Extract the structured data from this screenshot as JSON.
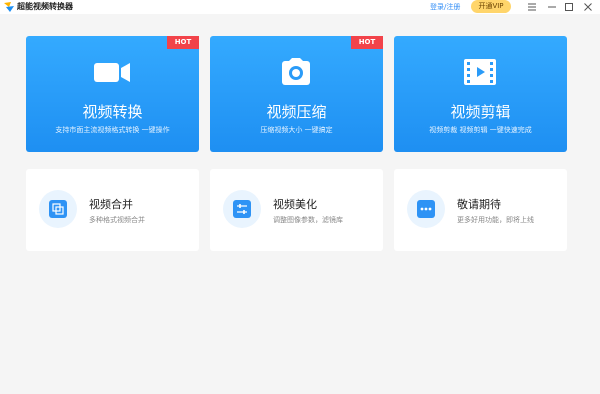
{
  "app": {
    "title": "超能视频转换器"
  },
  "header": {
    "login_label": "登录/注册",
    "vip_label": "开通VIP"
  },
  "window_controls": [
    "menu-icon",
    "minimize-icon",
    "maximize-icon",
    "close-icon"
  ],
  "colors": {
    "accent": "#2e93f5",
    "card_blue": "#1e8ff2",
    "hot_badge": "#f2434a",
    "vip": "#ffd56b"
  },
  "features": [
    {
      "title": "视频转换",
      "subtitle": "支持市面主流视频格式转换 一键操作",
      "badge": "HOT",
      "icon": "video-camera-icon"
    },
    {
      "title": "视频压缩",
      "subtitle": "压缩视频大小 一键搞定",
      "badge": "HOT",
      "icon": "camera-icon"
    },
    {
      "title": "视频剪辑",
      "subtitle": "视频剪裁 视频剪辑 一键快速完成",
      "icon": "film-icon"
    }
  ],
  "tools": [
    {
      "title": "视频合并",
      "subtitle": "多种格式视频合并",
      "icon": "merge-icon"
    },
    {
      "title": "视频美化",
      "subtitle": "调整图像参数，滤镜库",
      "icon": "adjust-icon"
    },
    {
      "title": "敬请期待",
      "subtitle": "更多好用功能，即将上线",
      "icon": "more-icon"
    }
  ]
}
